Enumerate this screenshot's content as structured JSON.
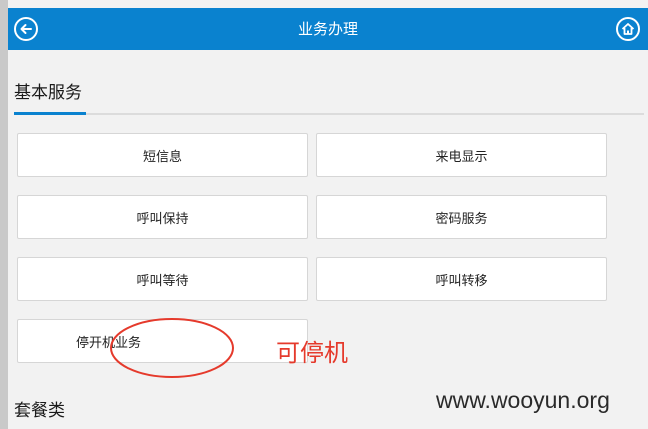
{
  "header": {
    "title": "业务办理",
    "back_icon": "back-arrow-icon",
    "home_icon": "home-icon"
  },
  "section_basic": {
    "title": "基本服务",
    "items": [
      {
        "label": "短信息"
      },
      {
        "label": "来电显示"
      },
      {
        "label": "呼叫保持"
      },
      {
        "label": "密码服务"
      },
      {
        "label": "呼叫等待"
      },
      {
        "label": "呼叫转移"
      },
      {
        "label": "停开机业务"
      }
    ]
  },
  "annotation": {
    "text": "可停机",
    "color": "#e53a2c"
  },
  "section_package": {
    "title": "套餐类"
  },
  "watermark": "www.wooyun.org",
  "colors": {
    "accent": "#0a82cf"
  }
}
